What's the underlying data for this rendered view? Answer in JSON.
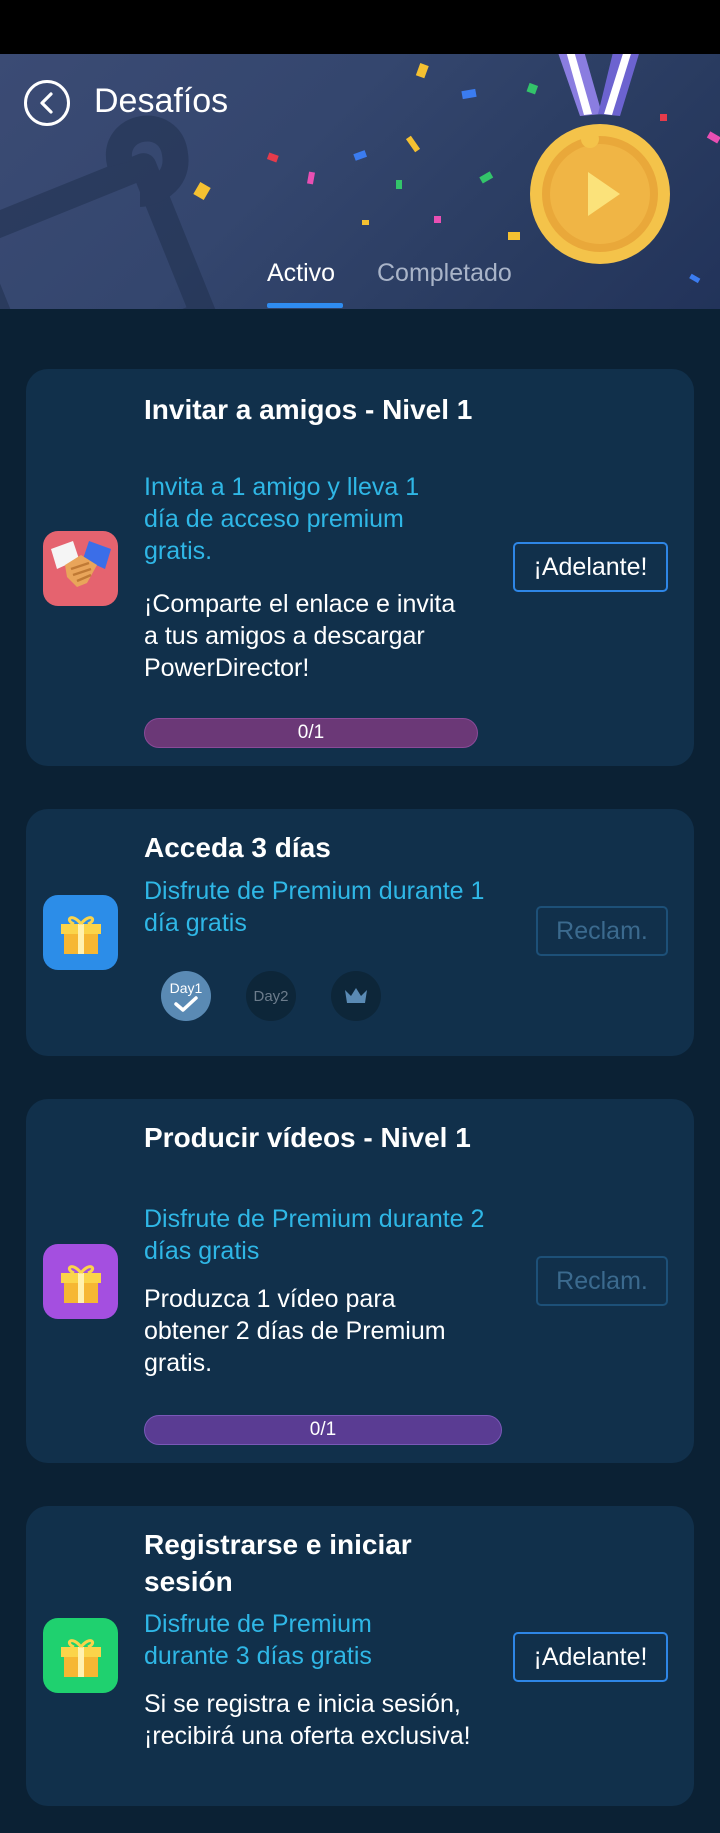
{
  "header": {
    "title": "Desafíos"
  },
  "tabs": [
    {
      "label": "Activo",
      "active": true
    },
    {
      "label": "Completado",
      "active": false
    }
  ],
  "challenges": [
    {
      "title": "Invitar a amigos - Nivel 1",
      "subtitle": "Invita a 1 amigo y lleva 1 día de acceso premium gratis.",
      "description": "¡Comparte el enlace e invita a tus amigos a descargar PowerDirector!",
      "button": "¡Adelante!",
      "button_state": "enabled",
      "progress": "0/1",
      "progress_value": 0,
      "icon": "handshake-icon",
      "icon_color": "#e5636f"
    },
    {
      "title": "Acceda 3 días",
      "subtitle": "Disfrute de Premium durante 1 día gratis",
      "button": "Reclam.",
      "button_state": "disabled",
      "days": [
        "Day1",
        "Day2"
      ],
      "day1_done": true,
      "icon": "gift-icon",
      "icon_color": "#2c8de8"
    },
    {
      "title": "Producir vídeos - Nivel 1",
      "subtitle": "Disfrute de Premium durante 2 días gratis",
      "description": "Produzca 1 vídeo para obtener 2 días de Premium gratis.",
      "button": "Reclam.",
      "button_state": "disabled",
      "progress": "0/1",
      "progress_value": 0,
      "icon": "gift-icon",
      "icon_color": "#a44fe0"
    },
    {
      "title": "Registrarse e iniciar sesión",
      "subtitle": "Disfrute de Premium durante 3 días gratis",
      "description": "Si se registra e inicia sesión, ¡recibirá una oferta exclusiva!",
      "button": "¡Adelante!",
      "button_state": "enabled",
      "icon": "gift-icon",
      "icon_color": "#1fd16f"
    }
  ],
  "colors": {
    "accent": "#2f8cf0",
    "subtitle": "#2fb7e6",
    "card_bg": "#11304b",
    "page_bg": "#0b2134"
  }
}
